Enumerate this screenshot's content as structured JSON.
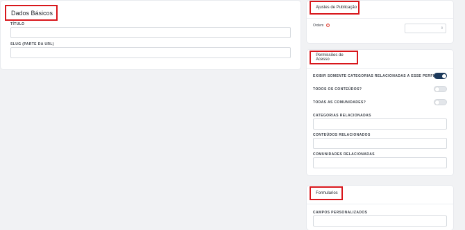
{
  "basic": {
    "title": "Dados Básicos",
    "fields": [
      {
        "label": "TÍTULO",
        "value": ""
      },
      {
        "label": "SLUG (PARTE DA URL)",
        "value": ""
      }
    ]
  },
  "publication": {
    "title": "Ajustes de Publicação",
    "order_label": "Ordem",
    "order_value": ""
  },
  "permissions": {
    "title": "Permissões de Acesso",
    "toggles": [
      {
        "label": "EXIBIR SOMENTE CATEGORIAS RELACIONADAS A ESSE PERFIL?",
        "on": true
      },
      {
        "label": "TODOS OS CONTEÚDOS?",
        "on": false
      },
      {
        "label": "TODAS AS COMUNIDADES?",
        "on": false
      }
    ],
    "fields": [
      {
        "label": "CATEGORIAS RELACIONADAS"
      },
      {
        "label": "CONTEÚDOS RELACIONADOS"
      },
      {
        "label": "COMUNIDADES RELACIONADAS"
      }
    ]
  },
  "forms": {
    "title": "Formularios",
    "fields": [
      {
        "label": "CAMPOS PERSONALIZADOS"
      }
    ]
  },
  "colors": {
    "highlight": "#d8161b",
    "toggle_on": "#1d3a5c",
    "help_icon": "#e0473b"
  }
}
